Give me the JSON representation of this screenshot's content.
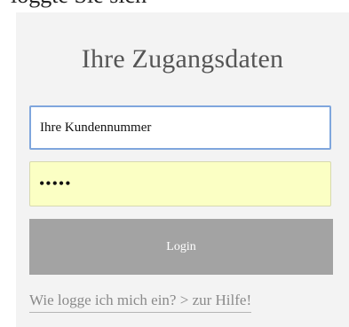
{
  "top_text": "loggte Sie sich",
  "title": "Ihre Zugangsdaten",
  "username": {
    "value": "Ihre Kundennummer"
  },
  "password": {
    "value": "•••••"
  },
  "login_label": "Login",
  "help_link": "Wie logge ich mich ein? > zur Hilfe!",
  "colors": {
    "panel_bg": "#f3f3f3",
    "input_focus_border": "#7fa6dd",
    "autofill_bg": "#fbffc4",
    "button_bg": "#a3a3a3"
  }
}
